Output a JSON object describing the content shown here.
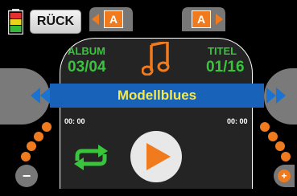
{
  "header": {
    "back_label": "RÜCK"
  },
  "tabs": [
    {
      "label": "A"
    },
    {
      "label": "A"
    }
  ],
  "player": {
    "album_label": "ALBUM",
    "album_value": "03/04",
    "title_label": "TITEL",
    "title_value": "01/16",
    "track_name": "Modellblues",
    "time_elapsed": "00: 00",
    "time_total": "00: 00"
  },
  "controls": {
    "minus_label": "−",
    "plus_label": "+"
  },
  "colors": {
    "accent_orange": "#f07a1e",
    "label_green": "#38c43b",
    "title_bar_blue": "#1863b9",
    "title_text_yellow": "#f4e84a"
  }
}
